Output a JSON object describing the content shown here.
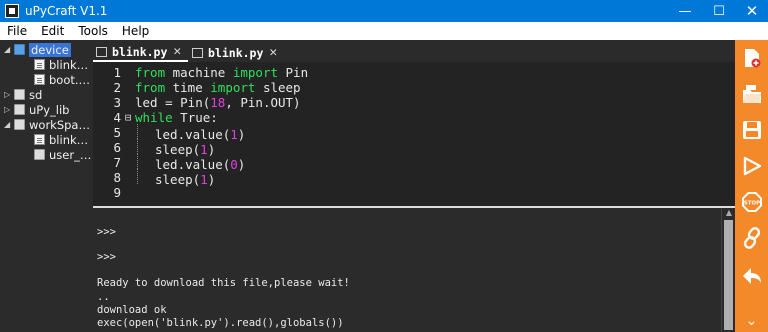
{
  "window": {
    "title": "uPyCraft V1.1",
    "controls": {
      "minimize": "—",
      "maximize": "☐",
      "close": "✕"
    }
  },
  "menu": {
    "items": [
      "File",
      "Edit",
      "Tools",
      "Help"
    ]
  },
  "tree": {
    "nodes": [
      {
        "label": "device",
        "icon": "folder-icon",
        "arrow": "◢",
        "selected": true
      },
      {
        "label": "blink…",
        "icon": "file-icon"
      },
      {
        "label": "boot.…",
        "icon": "file-icon"
      },
      {
        "label": "sd",
        "icon": "folder-icon",
        "arrow": "▷"
      },
      {
        "label": "uPy_lib",
        "icon": "folder-icon",
        "arrow": "▷"
      },
      {
        "label": "workSpa…",
        "icon": "folder-icon",
        "arrow": "◢"
      },
      {
        "label": "blink…",
        "icon": "file-icon"
      },
      {
        "label": "user_…",
        "icon": "folder-icon"
      }
    ]
  },
  "tabs": [
    {
      "label": "blink.py",
      "close": "✕",
      "active": true
    },
    {
      "label": "blink.py",
      "close": "✕",
      "active": false
    }
  ],
  "editor": {
    "fold_marker": "⊟",
    "lines": [
      {
        "num": "1",
        "a": "from",
        "b": " machine ",
        "c": "import",
        "d": " Pin"
      },
      {
        "num": "2",
        "a": "from",
        "b": " time ",
        "c": "import",
        "d": " sleep"
      },
      {
        "num": "3",
        "pre": "led = Pin(",
        "n": "18",
        "post": ", Pin.OUT)"
      },
      {
        "num": "4",
        "a": "while",
        "b": " True:"
      },
      {
        "num": "5",
        "pre": "led.value(",
        "n": "1",
        "post": ")"
      },
      {
        "num": "6",
        "pre": "sleep(",
        "n": "1",
        "post": ")"
      },
      {
        "num": "7",
        "pre": "led.value(",
        "n": "0",
        "post": ")"
      },
      {
        "num": "8",
        "pre": "sleep(",
        "n": "1",
        "post": ")"
      },
      {
        "num": "9"
      }
    ]
  },
  "console": {
    "lines": [
      ">>>",
      ">>>",
      "Ready to download this file,please wait!",
      "..",
      "download ok",
      "exec(open('blink.py').read(),globals())"
    ]
  },
  "toolbar": {
    "buttons": [
      "new-file-icon",
      "open-folder-icon",
      "save-icon",
      "download-run-icon",
      "stop-icon",
      "connect-icon",
      "undo-icon",
      "more-icon"
    ],
    "stop_label": "STOP",
    "more_glyph": "⌄",
    "color": "#f4892a"
  },
  "colors": {
    "keyword": "#2ee05a",
    "number": "#e040e0",
    "titlebar": "#0078d7",
    "panel": "#2b2b2b"
  }
}
